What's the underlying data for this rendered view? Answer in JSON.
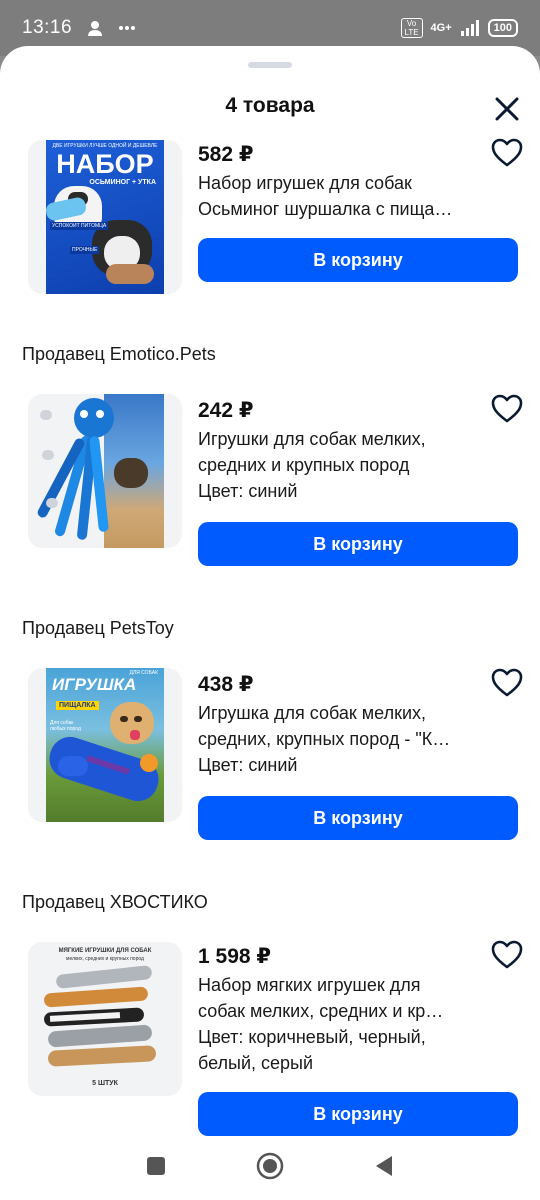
{
  "status_bar": {
    "time": "13:16",
    "network": "4G+",
    "volte": "Vo LTE",
    "battery": "100"
  },
  "sheet": {
    "title": "4 товара",
    "icons": {
      "close": "close-icon",
      "heart": "heart-outline-icon"
    }
  },
  "items": [
    {
      "price": "582 ₽",
      "title_line1": "Набор игрушек для собак",
      "title_line2": "Осьминог шуршалка с пища…",
      "cart_label": "В корзину",
      "image_text": {
        "top": "ДВЕ ИГРУШКИ ЛУЧШЕ ОДНОЙ И ДЕШЕВЛЕ",
        "main": "НАБОР",
        "sub": "ОСЬМИНОГ + УТКА",
        "tag1": "УСПОКОИТ ПИТОМЦА",
        "tag2": "ПРОЧНЫЕ"
      }
    },
    {
      "seller": "Продавец Emotico.Pets",
      "price": "242 ₽",
      "title_line1": "Игрушки для собак мелких,",
      "title_line2": "средних и крупных пород",
      "attr": "Цвет: синий",
      "cart_label": "В корзину"
    },
    {
      "seller": "Продавец PetsToy",
      "price": "438 ₽",
      "title_line1": "Игрушка для собак мелких,",
      "title_line2": "средних, крупных пород - \"К…",
      "attr": "Цвет: синий",
      "cart_label": "В корзину",
      "image_text": {
        "top": "ДЛЯ СОБАК",
        "main": "ИГРУШКА",
        "sub": "ПИЩАЛКА",
        "tag1": "Для собак любых пород"
      }
    },
    {
      "seller": "Продавец ХВОСТИКО",
      "price": "1 598 ₽",
      "title_line1": "Набор мягких игрушек для",
      "title_line2": "собак мелких, средних и кр…",
      "attr_line1": "Цвет: коричневый, черный,",
      "attr_line2": "белый, серый",
      "cart_label": "В корзину",
      "image_text": {
        "top1": "МЯГКИЕ ИГРУШКИ ДЛЯ СОБАК",
        "top2": "мелких, средних и крупных пород",
        "bottom": "5 ШТУК"
      }
    }
  ],
  "colors": {
    "accent": "#005bff",
    "thumb_bg": "#f2f3f5"
  }
}
